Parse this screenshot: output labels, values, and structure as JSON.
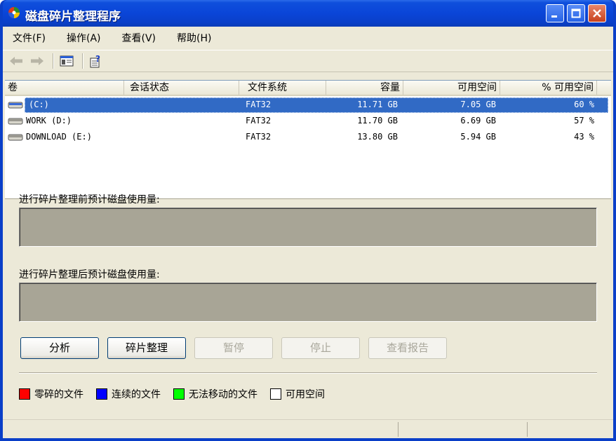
{
  "window": {
    "title": "磁盘碎片整理程序"
  },
  "menu": [
    "文件(F)",
    "操作(A)",
    "查看(V)",
    "帮助(H)"
  ],
  "toolbar": {
    "icons": [
      "back-arrow-icon",
      "forward-arrow-icon",
      "console-tree-icon",
      "help-properties-icon"
    ]
  },
  "list": {
    "columns": [
      "卷",
      "会话状态",
      "文件系统",
      "容量",
      "可用空间",
      "% 可用空间"
    ],
    "rows": [
      {
        "volume": "(C:)",
        "session": "",
        "fs": "FAT32",
        "capacity": "11.71 GB",
        "free": "7.05 GB",
        "pct": "60 %",
        "selected": true
      },
      {
        "volume": "WORK (D:)",
        "session": "",
        "fs": "FAT32",
        "capacity": "11.70 GB",
        "free": "6.69 GB",
        "pct": "57 %",
        "selected": false
      },
      {
        "volume": "DOWNLOAD (E:)",
        "session": "",
        "fs": "FAT32",
        "capacity": "13.80 GB",
        "free": "5.94 GB",
        "pct": "43 %",
        "selected": false
      }
    ]
  },
  "before_label": "进行碎片整理前预计磁盘使用量:",
  "after_label": "进行碎片整理后预计磁盘使用量:",
  "buttons": {
    "analyze": "分析",
    "defragment": "碎片整理",
    "pause": "暂停",
    "stop": "停止",
    "view_report": "查看报告"
  },
  "legend": [
    {
      "label": "零碎的文件",
      "color": "#ff0000"
    },
    {
      "label": "连续的文件",
      "color": "#0000ff"
    },
    {
      "label": "无法移动的文件",
      "color": "#00ff00"
    },
    {
      "label": "可用空间",
      "color": "#ffffff"
    }
  ]
}
